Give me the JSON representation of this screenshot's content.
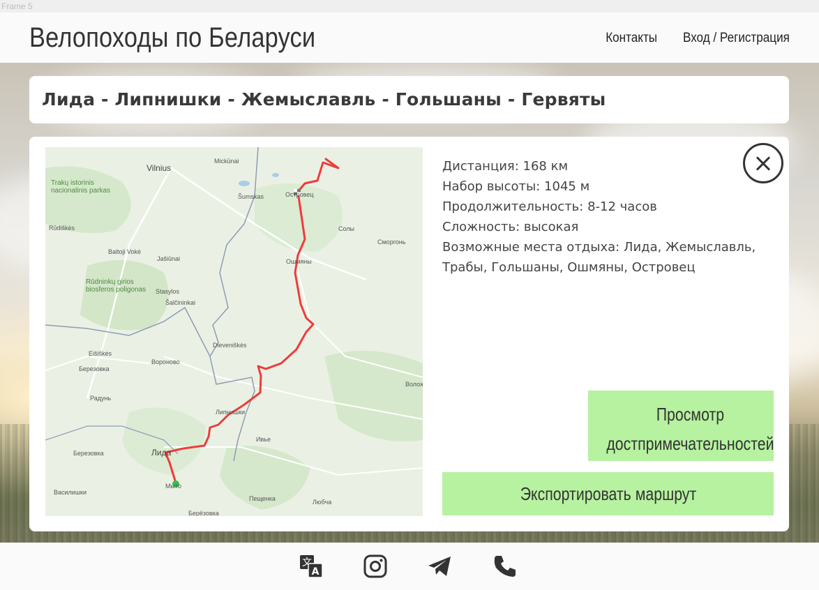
{
  "frame": {
    "label": "Frame 5"
  },
  "header": {
    "title": "Велопоходы по Беларуси",
    "nav": {
      "contacts": "Контакты",
      "login": "Вход / Регистрация"
    }
  },
  "route": {
    "title": "Лида - Липнишки - Жемыславль - Гольшаны - Гервяты",
    "distance": "Дистанция: 168 км",
    "elevation": "Набор высоты: 1045 м",
    "duration": "Продолжительность: 8-12 часов",
    "difficulty": "Сложность: высокая",
    "rest_places": "Возможные места отдыха: Лида, Жемыславль, Трабы, Гольшаны, Ошмяны, Островец"
  },
  "map": {
    "labels": {
      "vilnius": "Vilnius",
      "mickunai": "Mickūnai",
      "trakai_park": "Trakų istorinis nacionalinis parkas",
      "sumskas": "Šumskas",
      "ostrovets": "Островец",
      "rudiskes": "Rūdiškės",
      "soly": "Солы",
      "smorgon": "Сморгонь",
      "baltoji_voke": "Baltoji Vokė",
      "jasiunai": "Jašiūnai",
      "oshmyany": "Ошмяны",
      "rudninku_park": "Rūdninkų girios biosferos poligonas",
      "stasylos": "Stasylos",
      "salcininkai": "Šalčininkai",
      "eisiskes": "Eišiškės",
      "dieveniskes": "Dieveniškės",
      "berezovka1": "Березовка",
      "voronovo": "Вороново",
      "volozhin": "Волож",
      "radun": "Радунь",
      "lipnishki": "Липнишки",
      "berezovka2": "Березовка",
      "lida": "Лида",
      "ivye": "Ивье",
      "minojty": "Мыто",
      "vasilishki": "Василишки",
      "pesharka": "Пещенка",
      "lyubcha": "Любча",
      "beryozovka3": "Берёзовка"
    }
  },
  "buttons": {
    "sights": "Просмотр достпримечательностей",
    "export": "Экспортировать маршрут"
  },
  "colors": {
    "accent_green": "#b6f2a0",
    "route_red": "#ef3b3b",
    "start_green": "#2fc24a"
  },
  "footer": {
    "icons": [
      "translate-icon",
      "instagram-icon",
      "telegram-icon",
      "phone-icon"
    ]
  }
}
